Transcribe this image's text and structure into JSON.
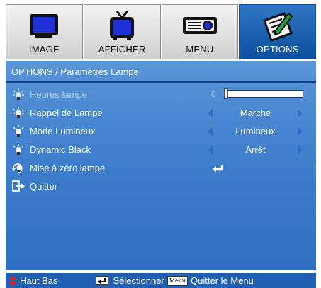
{
  "tabs": [
    {
      "label": "IMAGE",
      "icon": "monitor-icon",
      "active": false
    },
    {
      "label": "AFFICHER",
      "icon": "tv-icon",
      "active": false
    },
    {
      "label": "MENU",
      "icon": "projector-icon",
      "active": false
    },
    {
      "label": "OPTIONS",
      "icon": "notepad-pencil-icon",
      "active": true
    }
  ],
  "panel": {
    "title": "OPTIONS / Paramètres Lampe"
  },
  "items": {
    "lamp_hours": {
      "label": "Heures lampe",
      "value": "0",
      "progress_fraction": 0.0
    },
    "lamp_reminder": {
      "label": "Rappel de Lampe",
      "value": "Marche"
    },
    "brightness_mode": {
      "label": "Mode Lumineux",
      "value": "Lumineux"
    },
    "dynamic_black": {
      "label": "Dynamic Black",
      "value": "Arrêt"
    },
    "lamp_reset": {
      "label": "Mise à zéro lampe"
    },
    "quit": {
      "label": "Quitter"
    }
  },
  "footer": {
    "nav_label": "Haut Bas",
    "select_label": "Sélectionner",
    "menu_key": "Menu",
    "quit_menu_label": "Quitter le Menu"
  },
  "colors": {
    "accent": "#3f7fcc",
    "footer": "#1f5fb4",
    "active_tab": "#2e78c6",
    "arrow": "#2b6cc7",
    "nav_red": "#e0201c"
  }
}
